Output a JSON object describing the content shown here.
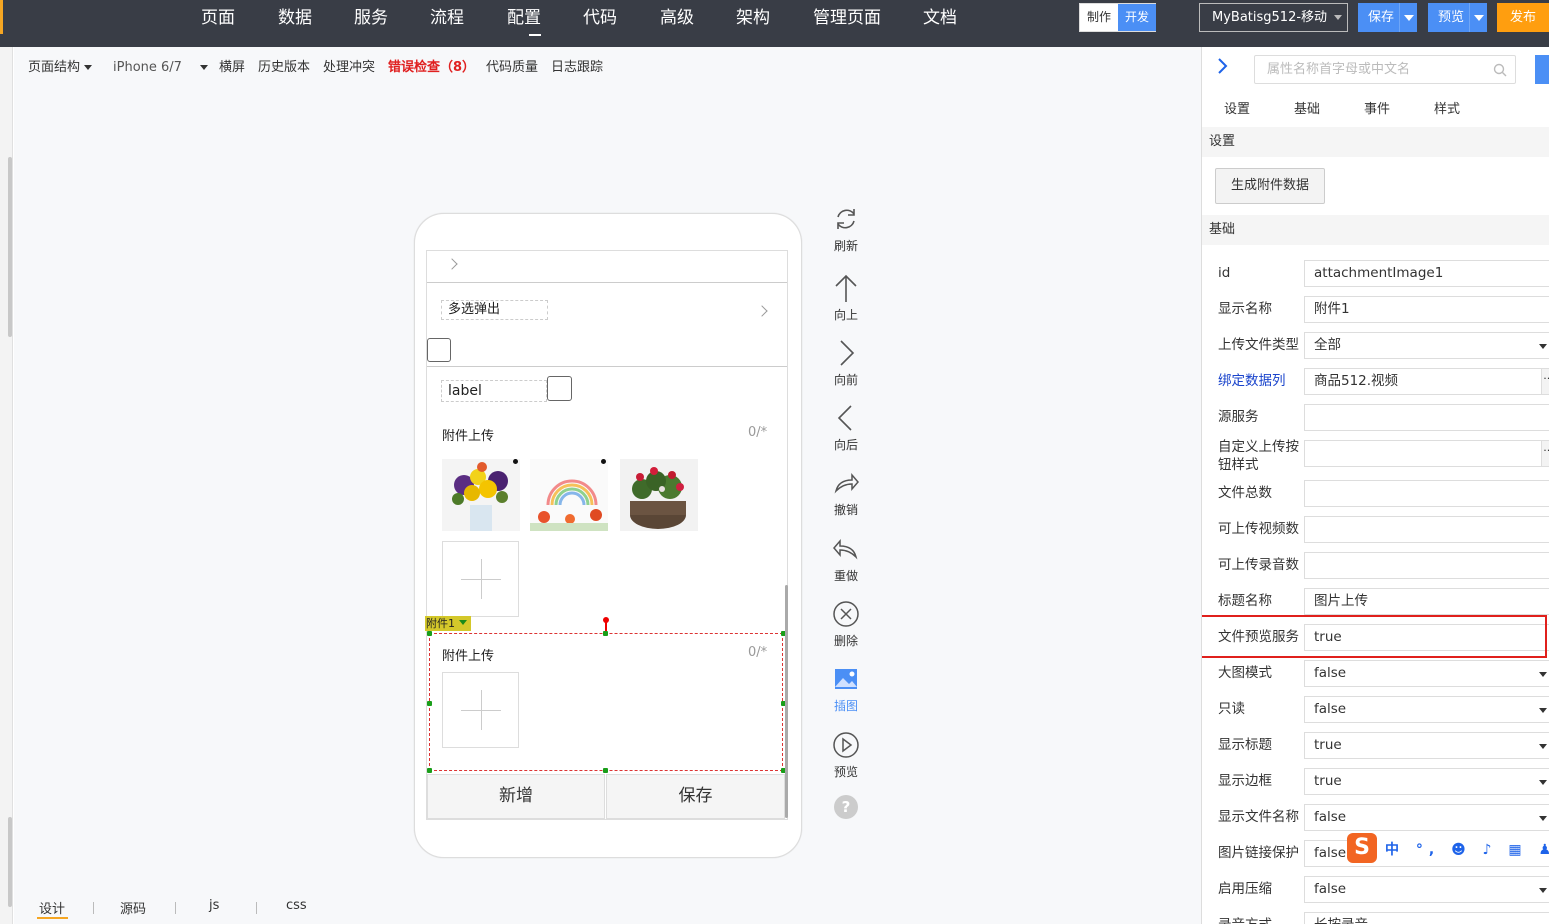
{
  "topnav": {
    "items": [
      "页面",
      "数据",
      "服务",
      "流程",
      "配置",
      "代码",
      "高级",
      "架构",
      "管理页面",
      "文档"
    ],
    "active": "配置",
    "mode_make": "制作",
    "mode_dev": "开发",
    "project": "MyBatisg512-移动",
    "save": "保存",
    "preview": "预览",
    "publish": "发布"
  },
  "toolbar": {
    "structure": "页面结构",
    "device": "iPhone 6/7",
    "landscape": "横屏",
    "history": "历史版本",
    "conflict": "处理冲突",
    "errors": "错误检查（8）",
    "quality": "代码质量",
    "log": "日志跟踪"
  },
  "phone": {
    "multi_popup": "多选弹出",
    "label_text": "label",
    "upload1_title": "附件上传",
    "upload1_count": "0/*",
    "upload2_title": "附件上传",
    "upload2_count": "0/*",
    "selected_tag": "附件1",
    "btn_add": "新增",
    "btn_save": "保存"
  },
  "sideops": [
    "刷新",
    "向上",
    "向前",
    "向后",
    "撤销",
    "重做",
    "删除",
    "插图",
    "预览"
  ],
  "bottomtabs": [
    "设计",
    "源码",
    "js",
    "css"
  ],
  "panel": {
    "search_placeholder": "属性名称首字母或中文名",
    "tabs": [
      "设置",
      "基础",
      "事件",
      "样式"
    ],
    "section_settings": "设置",
    "gen_button": "生成附件数据",
    "section_basic": "基础",
    "props": [
      {
        "label": "id",
        "value": "attachmentImage1",
        "kind": "text"
      },
      {
        "label": "显示名称",
        "value": "附件1",
        "kind": "text"
      },
      {
        "label": "上传文件类型",
        "value": "全部",
        "kind": "select"
      },
      {
        "label": "绑定数据列",
        "value": "商品512.视频",
        "kind": "dots",
        "link": true
      },
      {
        "label": "源服务",
        "value": "",
        "kind": "text"
      },
      {
        "label": "自定义上传按钮样式",
        "value": "",
        "kind": "dots"
      },
      {
        "label": "文件总数",
        "value": "",
        "kind": "text"
      },
      {
        "label": "可上传视频数",
        "value": "",
        "kind": "text"
      },
      {
        "label": "可上传录音数",
        "value": "",
        "kind": "text"
      },
      {
        "label": "标题名称",
        "value": "图片上传",
        "kind": "text"
      },
      {
        "label": "文件预览服务",
        "value": "true",
        "kind": "text"
      },
      {
        "label": "大图模式",
        "value": "false",
        "kind": "select"
      },
      {
        "label": "只读",
        "value": "false",
        "kind": "select"
      },
      {
        "label": "显示标题",
        "value": "true",
        "kind": "select"
      },
      {
        "label": "显示边框",
        "value": "true",
        "kind": "select"
      },
      {
        "label": "显示文件名称",
        "value": "false",
        "kind": "select"
      },
      {
        "label": "图片链接保护",
        "value": "false",
        "kind": "select"
      },
      {
        "label": "启用压缩",
        "value": "false",
        "kind": "select"
      },
      {
        "label": "录音方式",
        "value": "长按录音",
        "kind": "select"
      }
    ]
  },
  "ime": {
    "glyph": "S",
    "tools": "中 °, ☻ ♪ ▦ ♟ ✿"
  }
}
